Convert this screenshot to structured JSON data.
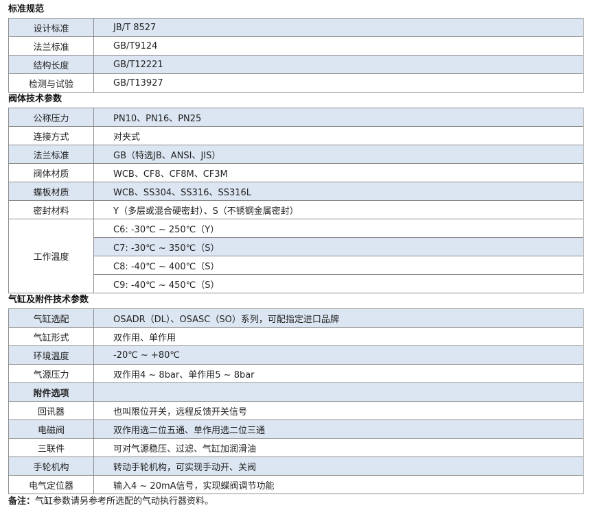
{
  "sections": [
    {
      "title": "标准规范",
      "rows": [
        {
          "k": "设计标准",
          "v": "JB/T 8527"
        },
        {
          "k": "法兰标准",
          "v": "GB/T9124"
        },
        {
          "k": "结构长度",
          "v": "GB/T12221"
        },
        {
          "k": "检测与试验",
          "v": "GB/T13927"
        }
      ]
    },
    {
      "title": "阀体技术参数",
      "rows": [
        {
          "k": "公称压力",
          "v": "PN10、PN16、PN25"
        },
        {
          "k": "连接方式",
          "v": "对夹式"
        },
        {
          "k": "法兰标准",
          "v": "GB（特选JB、ANSI、JIS）"
        },
        {
          "k": "阀体材质",
          "v": "WCB、CF8、CF8M、CF3M"
        },
        {
          "k": "蝶板材质",
          "v": "WCB、SS304、SS316、SS316L"
        },
        {
          "k": "密封材料",
          "v": "Y（多层或混合硬密封）、S（不锈钢金属密封）"
        }
      ],
      "temp": {
        "k": "工作温度",
        "values": [
          "C6: -30℃ ~ 250℃（Y）",
          "C7: -30℃ ~ 350℃（S）",
          "C8: -40℃ ~ 400℃（S）",
          "C9: -40℃ ~ 450℃（S）"
        ]
      }
    },
    {
      "title": "气缸及附件技术参数",
      "rows": [
        {
          "k": "气缸选配",
          "v": "OSADR（DL）、OSASC（SO）系列，可配指定进口品牌"
        },
        {
          "k": "气缸形式",
          "v": "双作用、单作用"
        },
        {
          "k": "环境温度",
          "v": "-20℃ ~ +80℃"
        },
        {
          "k": "气源压力",
          "v": "双作用4 ~ 8bar、单作用5 ~ 8bar"
        },
        {
          "k": "附件选项",
          "v": ""
        },
        {
          "k": "回讯器",
          "v": "也叫限位开关，远程反馈开关信号"
        },
        {
          "k": "电磁阀",
          "v": "双作用选二位五通、单作用选二位三通"
        },
        {
          "k": "三联件",
          "v": "可对气源稳压、过滤、气缸加润滑油"
        },
        {
          "k": "手轮机构",
          "v": "转动手轮机构，可实现手动开、关阀"
        },
        {
          "k": "电气定位器",
          "v": "输入4 ~ 20mA信号，实现蝶阀调节功能"
        }
      ]
    }
  ],
  "note": {
    "label": "备注：",
    "text": "气缸参数请另参考所选配的气动执行器资料。"
  }
}
